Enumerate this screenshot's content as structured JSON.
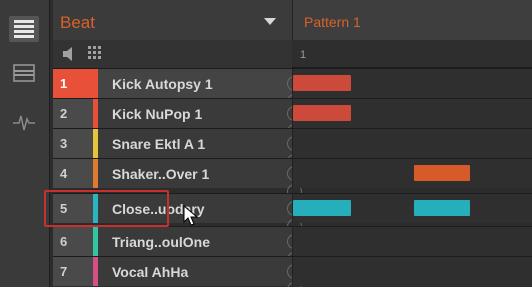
{
  "group": {
    "name": "Beat"
  },
  "pattern": {
    "name": "Pattern 1",
    "ruler_mark": "1"
  },
  "sounds": [
    {
      "num": "1",
      "name": "Kick Autopsy 1",
      "color": "#e8503a",
      "selected": true
    },
    {
      "num": "2",
      "name": "Kick NuPop 1",
      "color": "#e8503a",
      "selected": false
    },
    {
      "num": "3",
      "name": "Snare Ektl A 1",
      "color": "#e6c53a",
      "selected": false
    },
    {
      "num": "4",
      "name": "Shaker..Over 1",
      "color": "#e07a30",
      "selected": false
    },
    {
      "num": "5",
      "name": "Close..uodary",
      "color": "#29b6c2",
      "selected": false
    },
    {
      "num": "6",
      "name": "Triang..oulOne",
      "color": "#32c6a0",
      "selected": false
    },
    {
      "num": "7",
      "name": "Vocal AhHa",
      "color": "#d84f86",
      "selected": false
    }
  ],
  "notes": [
    {
      "row": 1,
      "color": "#cc4a3c"
    },
    {
      "row": 2,
      "color": "#cc4a3c"
    },
    {
      "row": 4,
      "color": "#d65a2a"
    },
    {
      "row": 5,
      "color": "#27aebb"
    },
    {
      "row": 5,
      "color": "#27aebb"
    }
  ],
  "icons": {
    "list_view": "list-icon",
    "grid_view": "panel-icon",
    "waveform": "waveform-icon",
    "speaker": "speaker-icon",
    "keyboard": "grid-icon"
  }
}
